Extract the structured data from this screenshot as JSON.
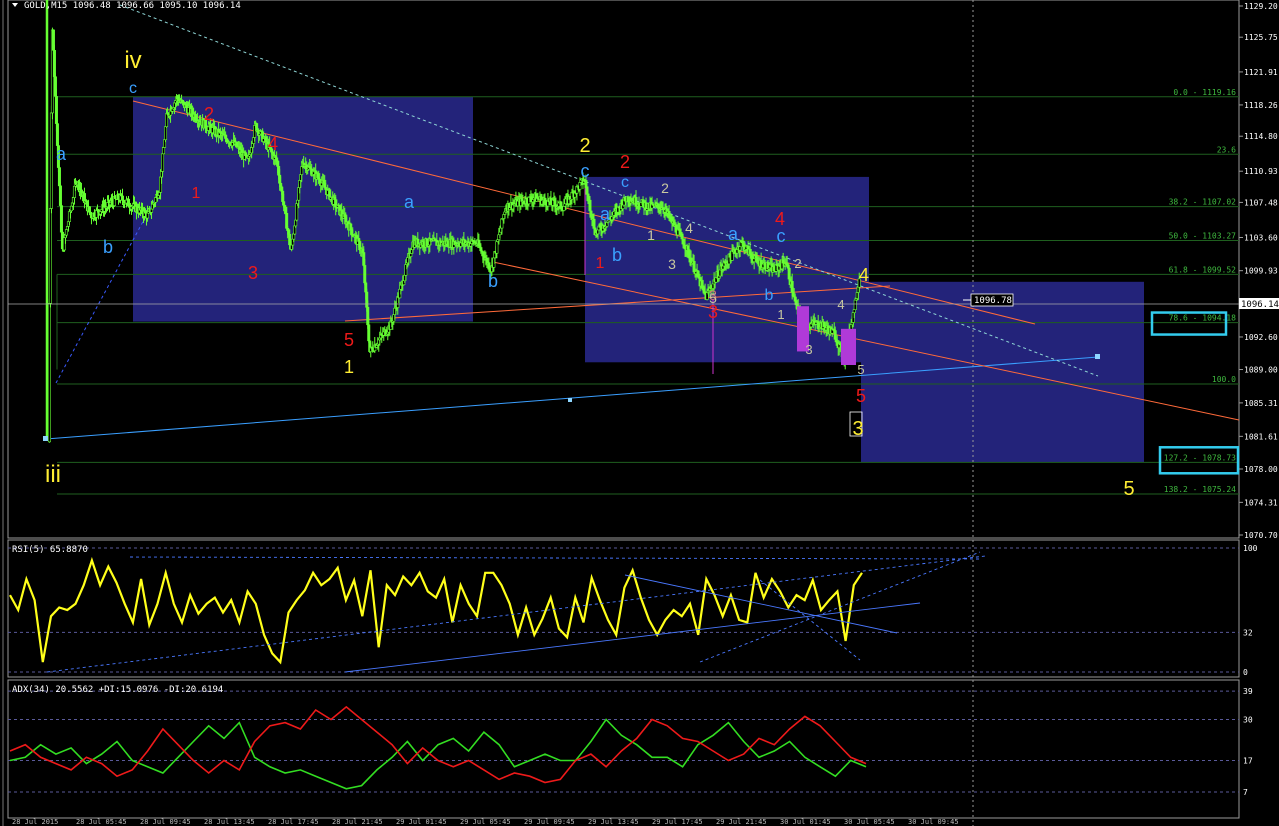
{
  "window": {
    "symbol_line": "GOLD,M15  1096.48 1096.66 1095.10 1096.14",
    "rsi_header": "RSI(5) 65.8870",
    "adx_header": "ADX(34) 20.5562 +DI:15.0976 -DI:20.6194",
    "current_price_label": "1096.14",
    "crosshair_label": "1096.78"
  },
  "colors": {
    "background": "#000000",
    "candles": "#66ff33",
    "grid": "#1f5f1f",
    "panel_box": "#23237a",
    "rsi_line": "#ffff1a",
    "adx_plus": "#33dd22",
    "adx_minus": "#ee1a1a",
    "trend_blue": "#3aa0ff",
    "trend_red": "#ff6a3a",
    "wave_yellow": "#ffee33",
    "wave_red": "#ee1a1a",
    "wave_blue": "#3aa0ff",
    "fib_text": "#3fb93f",
    "cyan_box": "#33ccee",
    "magenta": "#cc33cc"
  },
  "chart_data": [
    {
      "type": "candlestick",
      "symbol": "GOLD",
      "timeframe": "M15",
      "ohlc_last": [
        1096.48,
        1096.66,
        1095.1,
        1096.14
      ],
      "ylim": [
        1070.7,
        1129.2
      ],
      "y_tick_labels": [
        "1129.20",
        "1125.75",
        "1121.91",
        "1118.26",
        "1114.80",
        "1110.93",
        "1107.48",
        "1103.60",
        "1099.93",
        "1096.14",
        "1092.60",
        "1089.00",
        "1085.31",
        "1081.61",
        "1078.00",
        "1074.31",
        "1070.70"
      ],
      "price_path": [
        {
          "x": 0.0,
          "p": 1081
        },
        {
          "x": 0.3,
          "p": 1127
        },
        {
          "x": 1.0,
          "p": 1102
        },
        {
          "x": 2.0,
          "p": 1110
        },
        {
          "x": 3.0,
          "p": 1106
        },
        {
          "x": 5.0,
          "p": 1108
        },
        {
          "x": 7.0,
          "p": 1106
        },
        {
          "x": 7.8,
          "p": 1109
        },
        {
          "x": 8.3,
          "p": 1117
        },
        {
          "x": 9.0,
          "p": 1119
        },
        {
          "x": 11.0,
          "p": 1116
        },
        {
          "x": 13.0,
          "p": 1114
        },
        {
          "x": 14.0,
          "p": 1112
        },
        {
          "x": 14.5,
          "p": 1116
        },
        {
          "x": 16.0,
          "p": 1112
        },
        {
          "x": 17.0,
          "p": 1102
        },
        {
          "x": 17.8,
          "p": 1112
        },
        {
          "x": 19.0,
          "p": 1110
        },
        {
          "x": 21.0,
          "p": 1105
        },
        {
          "x": 22.0,
          "p": 1102
        },
        {
          "x": 22.5,
          "p": 1091
        },
        {
          "x": 24.0,
          "p": 1094
        },
        {
          "x": 25.5,
          "p": 1103
        },
        {
          "x": 28.0,
          "p": 1103
        },
        {
          "x": 30.0,
          "p": 1103
        },
        {
          "x": 31.0,
          "p": 1100
        },
        {
          "x": 32.0,
          "p": 1107
        },
        {
          "x": 34.0,
          "p": 1108
        },
        {
          "x": 36.0,
          "p": 1107
        },
        {
          "x": 37.5,
          "p": 1110
        },
        {
          "x": 38.3,
          "p": 1104
        },
        {
          "x": 39.5,
          "p": 1106
        },
        {
          "x": 40.5,
          "p": 1108
        },
        {
          "x": 42.0,
          "p": 1107
        },
        {
          "x": 43.0,
          "p": 1107
        },
        {
          "x": 44.5,
          "p": 1103
        },
        {
          "x": 46.0,
          "p": 1097
        },
        {
          "x": 47.0,
          "p": 1100
        },
        {
          "x": 48.5,
          "p": 1103
        },
        {
          "x": 49.5,
          "p": 1101
        },
        {
          "x": 50.8,
          "p": 1100
        },
        {
          "x": 51.6,
          "p": 1101
        },
        {
          "x": 52.3,
          "p": 1096
        },
        {
          "x": 53.0,
          "p": 1094
        },
        {
          "x": 54.0,
          "p": 1094
        },
        {
          "x": 55.0,
          "p": 1093
        },
        {
          "x": 55.7,
          "p": 1090
        },
        {
          "x": 56.4,
          "p": 1096
        },
        {
          "x": 56.8,
          "p": 1100
        }
      ]
    },
    {
      "type": "line",
      "name": "RSI(5)",
      "ylim": [
        0,
        100
      ],
      "levels": [
        100,
        32,
        0
      ],
      "y_tick_labels": [
        "100",
        "32",
        "0"
      ],
      "values": [
        62,
        50,
        75,
        58,
        8,
        45,
        52,
        50,
        55,
        70,
        90,
        70,
        85,
        72,
        55,
        40,
        75,
        38,
        55,
        80,
        55,
        40,
        62,
        47,
        55,
        60,
        48,
        58,
        40,
        65,
        55,
        30,
        15,
        8,
        48,
        58,
        66,
        80,
        70,
        75,
        84,
        58,
        74,
        45,
        82,
        20,
        70,
        62,
        77,
        70,
        80,
        65,
        60,
        75,
        40,
        70,
        55,
        45,
        80,
        80,
        70,
        55,
        30,
        52,
        30,
        43,
        60,
        35,
        28,
        60,
        40,
        76,
        58,
        42,
        30,
        68,
        82,
        60,
        42,
        30,
        42,
        50,
        45,
        55,
        30,
        75,
        62,
        45,
        62,
        42,
        40,
        80,
        60,
        75,
        65,
        52,
        62,
        58,
        74,
        50,
        58,
        65,
        25,
        70,
        80
      ]
    },
    {
      "type": "line",
      "name": "ADX(34)",
      "ylim": [
        0,
        40
      ],
      "y_tick_labels": [
        "39",
        "30",
        "17",
        "7"
      ],
      "series": [
        {
          "name": "+DI",
          "values": [
            17,
            18,
            22,
            19,
            21,
            16,
            19,
            23,
            17,
            15,
            13,
            18,
            23,
            28,
            24,
            29,
            18,
            15,
            13,
            14,
            12,
            10,
            8,
            9,
            14,
            18,
            23,
            17,
            22,
            24,
            20,
            26,
            22,
            15,
            17,
            19,
            17,
            17,
            23,
            30,
            25,
            22,
            18,
            18,
            15,
            22,
            25,
            29,
            23,
            18,
            20,
            23,
            18,
            15,
            12,
            17,
            15
          ]
        },
        {
          "name": "-DI",
          "values": [
            20,
            22,
            18,
            16,
            14,
            18,
            16,
            12,
            14,
            20,
            27,
            22,
            17,
            13,
            17,
            14,
            23,
            28,
            29,
            27,
            33,
            30,
            34,
            30,
            26,
            22,
            16,
            21,
            17,
            15,
            17,
            14,
            11,
            13,
            12,
            10,
            11,
            17,
            19,
            15,
            20,
            24,
            30,
            28,
            24,
            23,
            20,
            17,
            19,
            24,
            22,
            27,
            31,
            28,
            23,
            18,
            16
          ]
        }
      ]
    }
  ],
  "fib_levels": [
    {
      "label": "0.0 - 1119.16",
      "price": 1119.16
    },
    {
      "label": "23.6",
      "price": 1112.8
    },
    {
      "label": "38.2 - 1107.02",
      "price": 1107.02
    },
    {
      "label": "50.0 - 1103.27",
      "price": 1103.27
    },
    {
      "label": "61.8 - 1099.52",
      "price": 1099.52
    },
    {
      "label": "78.6 - 1094.18",
      "price": 1094.18
    },
    {
      "label": "100.0",
      "price": 1087.4
    },
    {
      "label": "127.2 - 1078.73",
      "price": 1078.73
    },
    {
      "label": "138.2 - 1075.24",
      "price": 1075.24
    }
  ],
  "wave_labels": {
    "yellow": [
      "iv",
      "iii",
      "2",
      "1",
      "4",
      "3",
      "5"
    ],
    "red": [
      "2",
      "1",
      "4",
      "3",
      "5",
      "2",
      "1",
      "3",
      "4",
      "3",
      "5"
    ],
    "blue": [
      "c",
      "a",
      "b",
      "a",
      "b",
      "c",
      "c",
      "a",
      "b",
      "a",
      "c",
      "b"
    ],
    "small": [
      "2",
      "1",
      "4",
      "3",
      "5",
      "2",
      "1",
      "3",
      "4",
      "5"
    ]
  },
  "x_axis_labels": [
    "28 Jul 2015",
    "28 Jul 05:45",
    "28 Jul 09:45",
    "28 Jul 13:45",
    "28 Jul 17:45",
    "28 Jul 21:45",
    "29 Jul 01:45",
    "29 Jul 05:45",
    "29 Jul 09:45",
    "29 Jul 13:45",
    "29 Jul 17:45",
    "29 Jul 21:45",
    "30 Jul 01:45",
    "30 Jul 05:45",
    "30 Jul 09:45"
  ]
}
